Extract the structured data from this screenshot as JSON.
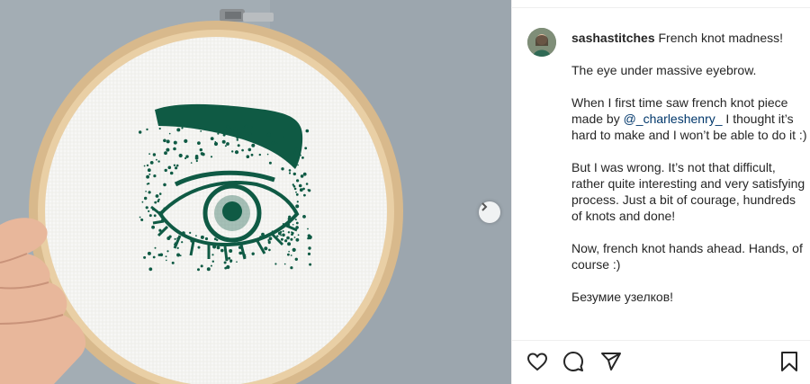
{
  "post": {
    "username": "sashastitches",
    "caption_first_line": "French knot madness!",
    "paragraphs": {
      "p2": "The eye under massive eyebrow.",
      "p3_before": "When I first time saw french knot piece made by ",
      "p3_mention": "@_charleshenry_",
      "p3_after": " I thought it’s hard to make and I won’t be able to do it :)",
      "p4": "But I was wrong. It’s not that difficult, rather quite interesting and very satisfying process. Just a bit of courage, hundreds of knots and done!",
      "p5": "Now, french knot hands ahead. Hands, of course :)",
      "p6": "Безумие узелков!"
    }
  },
  "icons": {
    "like": "heart-icon",
    "comment": "comment-icon",
    "share": "share-icon",
    "save": "bookmark-icon",
    "next": "chevron-right-icon"
  },
  "colors": {
    "thread_green": "#0f5a44",
    "mention": "#00376b",
    "text": "#262626"
  }
}
